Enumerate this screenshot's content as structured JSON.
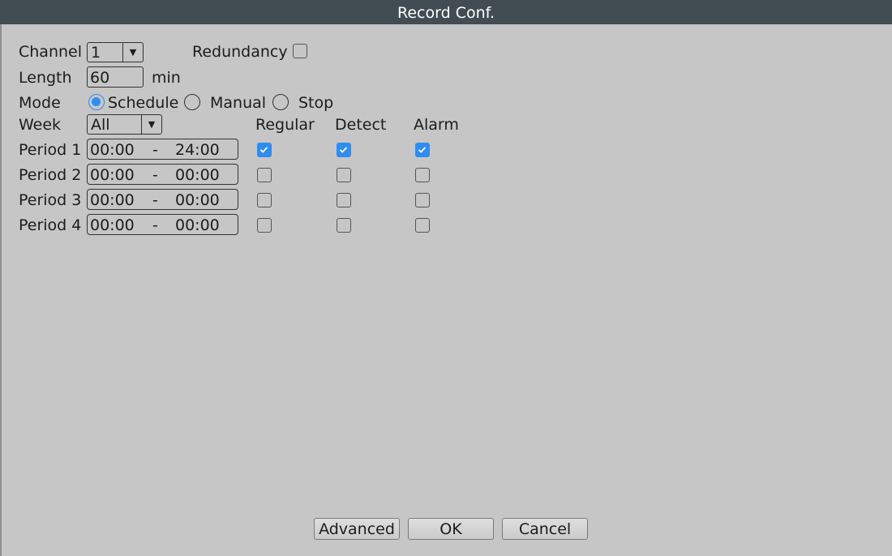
{
  "window": {
    "title": "Record Conf."
  },
  "channel": {
    "label": "Channel",
    "value": "1"
  },
  "redundancy": {
    "label": "Redundancy",
    "checked": false
  },
  "length": {
    "label": "Length",
    "value": "60",
    "unit": "min"
  },
  "mode": {
    "label": "Mode",
    "options": [
      {
        "label": "Schedule",
        "selected": true
      },
      {
        "label": "Manual",
        "selected": false
      },
      {
        "label": "Stop",
        "selected": false
      }
    ]
  },
  "week": {
    "label": "Week",
    "value": "All"
  },
  "columns": {
    "regular": "Regular",
    "detect": "Detect",
    "alarm": "Alarm"
  },
  "periods": [
    {
      "label": "Period 1",
      "start": "00:00",
      "end": "24:00",
      "regular": true,
      "detect": true,
      "alarm": true
    },
    {
      "label": "Period 2",
      "start": "00:00",
      "end": "00:00",
      "regular": false,
      "detect": false,
      "alarm": false
    },
    {
      "label": "Period 3",
      "start": "00:00",
      "end": "00:00",
      "regular": false,
      "detect": false,
      "alarm": false
    },
    {
      "label": "Period 4",
      "start": "00:00",
      "end": "00:00",
      "regular": false,
      "detect": false,
      "alarm": false
    }
  ],
  "time_separator": "-",
  "buttons": {
    "advanced": "Advanced",
    "ok": "OK",
    "cancel": "Cancel"
  },
  "colors": {
    "titlebar": "#414c53",
    "background": "#c6c6c6",
    "accent": "#2f8cf0"
  }
}
